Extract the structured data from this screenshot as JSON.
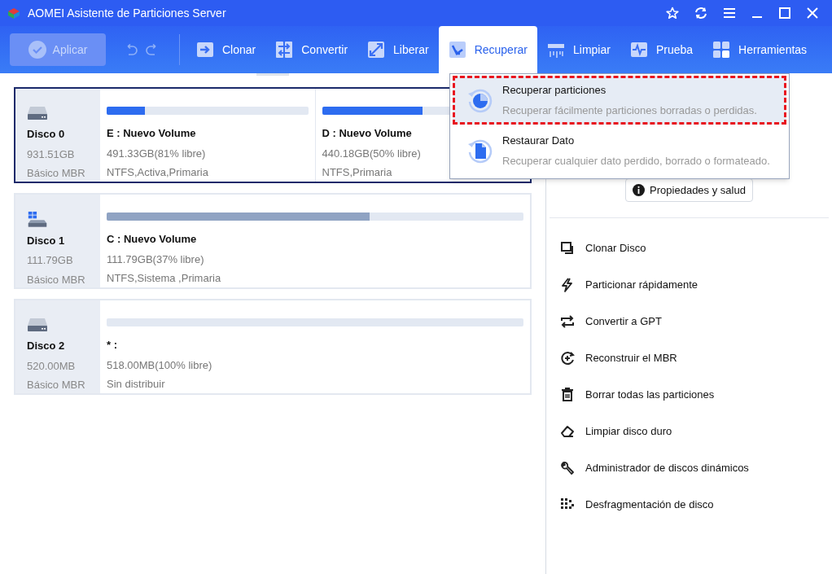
{
  "window": {
    "title": "AOMEI Asistente de Particiones Server"
  },
  "toolbar": {
    "apply": {
      "label": "Aplicar",
      "disabled": true
    },
    "tabs": [
      {
        "label": "Clonar",
        "kind": "clone",
        "selected": false
      },
      {
        "label": "Convertir",
        "kind": "convert",
        "selected": false
      },
      {
        "label": "Liberar",
        "kind": "free",
        "selected": false
      },
      {
        "label": "Recuperar",
        "kind": "recover",
        "selected": true
      },
      {
        "label": "Limpiar",
        "kind": "wipe",
        "selected": false
      },
      {
        "label": "Prueba",
        "kind": "test",
        "selected": false
      },
      {
        "label": "Herramientas",
        "kind": "tools",
        "selected": false
      }
    ]
  },
  "disks": [
    {
      "name": "Disco 0",
      "size": "931.51GB",
      "type": "Básico MBR",
      "kind": "hdd",
      "selected": true,
      "partitions": [
        {
          "name": "E : Nuevo Volume",
          "size": "491.33GB(81% libre)",
          "info": "NTFS,Activa,Primaria",
          "level": 0.19
        },
        {
          "name": "D : Nuevo Volume",
          "size": "440.18GB(50% libre)",
          "info": "NTFS,Primaria",
          "level": 0.5
        }
      ]
    },
    {
      "name": "Disco 1",
      "size": "111.79GB",
      "type": "Básico MBR",
      "kind": "system",
      "selected": false,
      "partitions": [
        {
          "name": "C : Nuevo Volume",
          "size": "111.79GB(37% libre)",
          "info": "NTFS,Sistema ,Primaria",
          "level": 0.63
        }
      ]
    },
    {
      "name": "Disco 2",
      "size": "520.00MB",
      "type": "Básico MBR",
      "kind": "hdd",
      "selected": false,
      "partitions": [
        {
          "name": "* :",
          "size": "518.00MB(100% libre)",
          "info": "Sin distribuir",
          "level": 0
        }
      ]
    }
  ],
  "dropdown": [
    {
      "title": "Recuperar particiones",
      "description": "Recuperar fácilmente particiones borradas o perdidas.",
      "kind": "partition",
      "selected": true
    },
    {
      "title": "Restaurar Dato",
      "description": "Recuperar cualquier dato perdido, borrado o formateado.",
      "kind": "file",
      "selected": false
    }
  ],
  "properties_button": "Propiedades y salud",
  "actions": [
    {
      "label": "Clonar Disco",
      "kind": "clone"
    },
    {
      "label": "Particionar rápidamente",
      "kind": "bolt"
    },
    {
      "label": "Convertir a GPT",
      "kind": "convert"
    },
    {
      "label": "Reconstruir el MBR",
      "kind": "rebuild"
    },
    {
      "label": "Borrar todas las particiones",
      "kind": "trash"
    },
    {
      "label": "Limpiar disco duro",
      "kind": "eraser"
    },
    {
      "label": "Administrador de discos dinámicos",
      "kind": "wrench"
    },
    {
      "label": "Desfragmentación de disco",
      "kind": "dots"
    }
  ]
}
